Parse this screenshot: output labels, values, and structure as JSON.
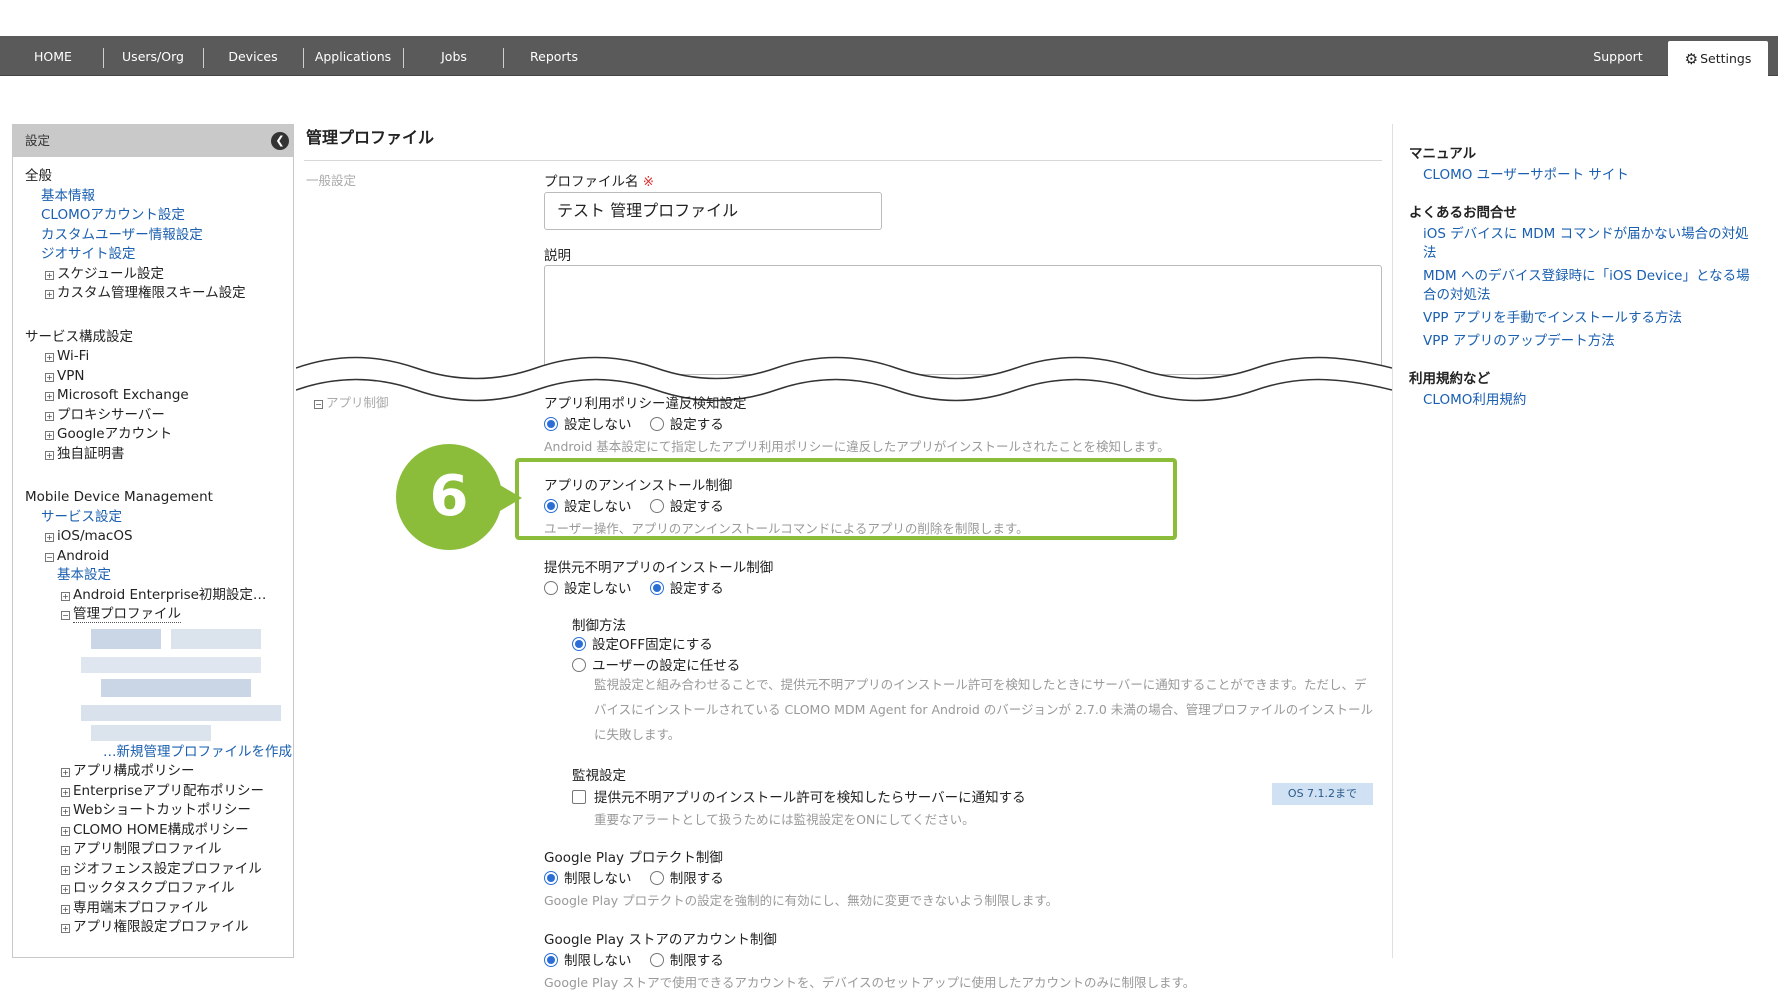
{
  "nav": {
    "items": [
      "HOME",
      "Users/Org",
      "Devices",
      "Applications",
      "Jobs",
      "Reports"
    ],
    "support": "Support",
    "settings": "Settings"
  },
  "sidebar": {
    "header": "設定",
    "general_group": "全般",
    "general_links": [
      "基本情報",
      "CLOMOアカウント設定",
      "カスタムユーザー情報設定",
      "ジオサイト設定"
    ],
    "general_tree": [
      "スケジュール設定",
      "カスタム管理権限スキーム設定"
    ],
    "service_group": "サービス構成設定",
    "service_tree": [
      "Wi-Fi",
      "VPN",
      "Microsoft Exchange",
      "プロキシサーバー",
      "Googleアカウント",
      "独自証明書"
    ],
    "mdm_group": "Mobile Device Management",
    "mdm_service_link": "サービス設定",
    "ios": "iOS/macOS",
    "android": "Android",
    "android_basic": "基本設定",
    "android_enterprise": "Android Enterprise初期設定…",
    "managed_profile": "管理プロファイル",
    "new_profile": "…新規管理プロファイルを作成",
    "android_tree": [
      "アプリ構成ポリシー",
      "Enterpriseアプリ配布ポリシー",
      "Webショートカットポリシー",
      "CLOMO HOME構成ポリシー",
      "アプリ制限プロファイル",
      "ジオフェンス設定プロファイル",
      "ロックタスクプロファイル",
      "専用端末プロファイル",
      "アプリ権限設定プロファイル"
    ]
  },
  "main": {
    "title": "管理プロファイル",
    "general_section": "一般設定",
    "profile_name_label": "プロファイル名",
    "required_mark": "※",
    "profile_name_value": "テスト 管理プロファイル",
    "description_label": "説明",
    "app_section": "アプリ制御",
    "violation": {
      "title": "アプリ利用ポリシー違反検知設定",
      "opt_off": "設定しない",
      "opt_on": "設定する",
      "help": "Android 基本設定にて指定したアプリ利用ポリシーに違反したアプリがインストールされたことを検知します。"
    },
    "uninstall": {
      "title": "アプリのアンインストール制御",
      "opt_off": "設定しない",
      "opt_on": "設定する",
      "help": "ユーザー操作、アプリのアンインストールコマンドによるアプリの削除を制限します。"
    },
    "unknown": {
      "title": "提供元不明アプリのインストール制御",
      "opt_off": "設定しない",
      "opt_on": "設定する",
      "method_label": "制御方法",
      "method_fixed": "設定OFF固定にする",
      "method_user": "ユーザーの設定に任せる",
      "method_help": "監視設定と組み合わせることで、提供元不明アプリのインストール許可を検知したときにサーバーに通知することができます。ただし、デバイスにインストールされている CLOMO MDM Agent for Android のバージョンが 2.7.0 未満の場合、管理プロファイルのインストールに失敗します。",
      "monitor_label": "監視設定",
      "monitor_checkbox": "提供元不明アプリのインストール許可を検知したらサーバーに通知する",
      "os_badge": "OS 7.1.2まで",
      "monitor_help": "重要なアラートとして扱うためには監視設定をONにしてください。"
    },
    "protect": {
      "title": "Google Play プロテクト制御",
      "opt_off": "制限しない",
      "opt_on": "制限する",
      "help": "Google Play プロテクトの設定を強制的に有効にし、無効に変更できないよう制限します。"
    },
    "store": {
      "title": "Google Play ストアのアカウント制御",
      "opt_off": "制限しない",
      "opt_on": "制限する",
      "help": "Google Play ストアで使用できるアカウントを、デバイスのセットアップに使用したアカウントのみに制限します。"
    },
    "step_marker": "6"
  },
  "right_panel": {
    "manual_head": "マニュアル",
    "manual_links": [
      "CLOMO ユーザーサポート サイト"
    ],
    "faq_head": "よくあるお問合せ",
    "faq_links": [
      "iOS デバイスに MDM コマンドが届かない場合の対処法",
      "MDM へのデバイス登録時に「iOS Device」となる場合の対処法",
      "VPP アプリを手動でインストールする方法",
      "VPP アプリのアップデート方法"
    ],
    "terms_head": "利用規約など",
    "terms_links": [
      "CLOMO利用規約"
    ]
  },
  "colors": {
    "accent_green": "#8bbd3b",
    "link_blue": "#1a5fb0",
    "nav_bg": "#5a5a5a",
    "radio_blue": "#2b6fd6"
  }
}
